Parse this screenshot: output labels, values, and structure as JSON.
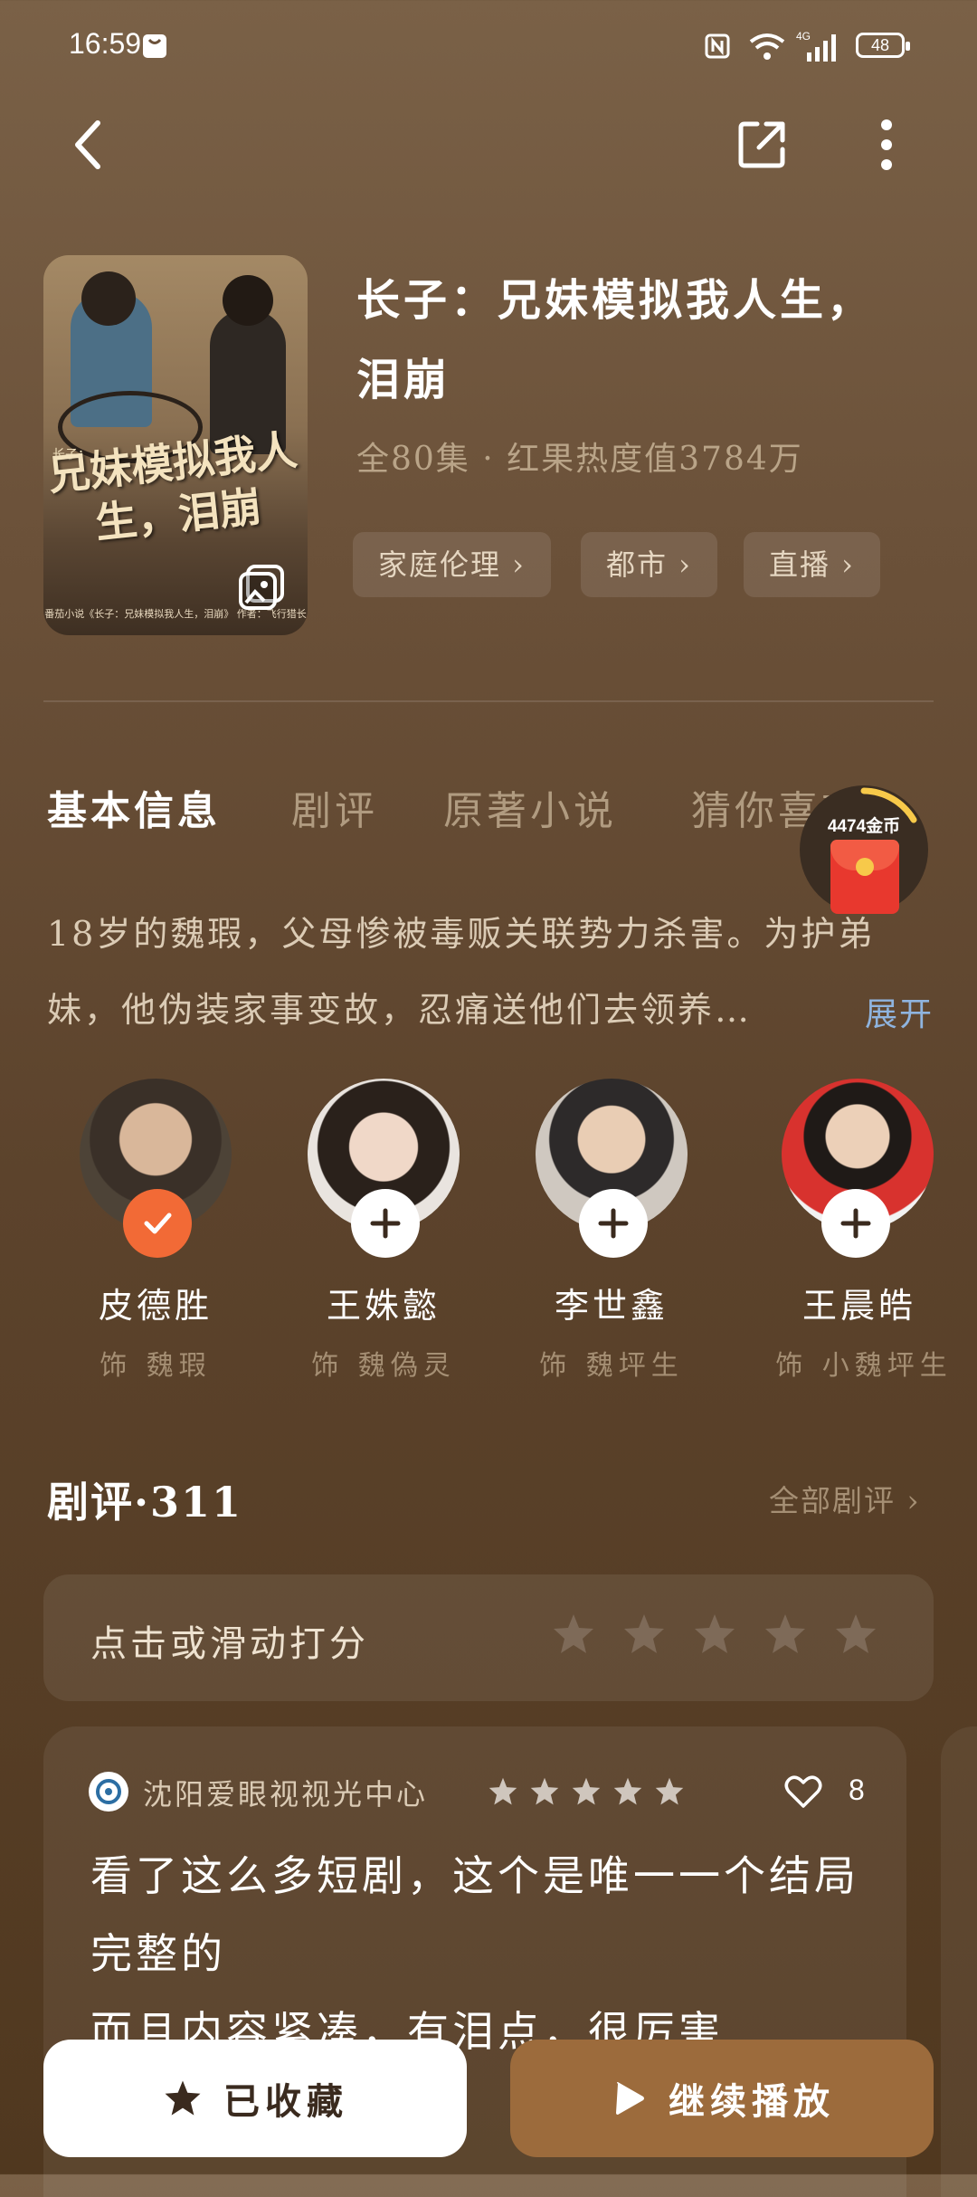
{
  "status_bar": {
    "time": "16:59",
    "battery": "48"
  },
  "nav": {
    "back_icon": "back-arrow-icon",
    "share_icon": "share-icon",
    "more_icon": "more-vertical-icon"
  },
  "drama": {
    "title": "长子：兄妹模拟我人生，泪崩",
    "meta": "全80集 · 红果热度值3784万",
    "poster_title": "兄妹模拟我人生，泪崩",
    "poster_prefix": "长子：",
    "poster_credit": "番茄小说《长子：兄妹模拟我人生，泪崩》 作者：飞行猎长",
    "tags": [
      "家庭伦理 ›",
      "都市 ›",
      "直播 ›"
    ]
  },
  "tabs": [
    "基本信息",
    "剧评",
    "原著小说",
    "猜你喜欢"
  ],
  "coin_widget": {
    "label": "4474金币",
    "accent": "#f7c94a"
  },
  "description": {
    "text": "18岁的魏瑕，父母惨被毒贩关联势力杀害。为护弟妹，他伪装家事变故，忍痛送他们去领养…",
    "expand": "展开"
  },
  "cast": [
    {
      "name": "皮德胜",
      "role": "饰  魏瑕",
      "followed": true
    },
    {
      "name": "王姝懿",
      "role": "饰  魏偽灵",
      "followed": false
    },
    {
      "name": "李世鑫",
      "role": "饰  魏坪生",
      "followed": false
    },
    {
      "name": "王晨皓",
      "role": "饰  小魏坪生",
      "followed": false
    }
  ],
  "reviews": {
    "header": "剧评·311",
    "all_link": "全部剧评 ›",
    "rate_prompt": "点击或滑动打分",
    "items": [
      {
        "user": "沈阳爱眼视视光中心",
        "stars": 5,
        "likes": "8",
        "text": "看了这么多短剧，这个是唯一一个结局完整的\n而且内容紧凑，有泪点，很厉害…"
      }
    ]
  },
  "actions": {
    "collect": "已收藏",
    "play": "继续播放"
  },
  "colors": {
    "accent_orange": "#f26a36",
    "play_button": "#9c6b3c",
    "link_blue": "#8fb4df"
  }
}
